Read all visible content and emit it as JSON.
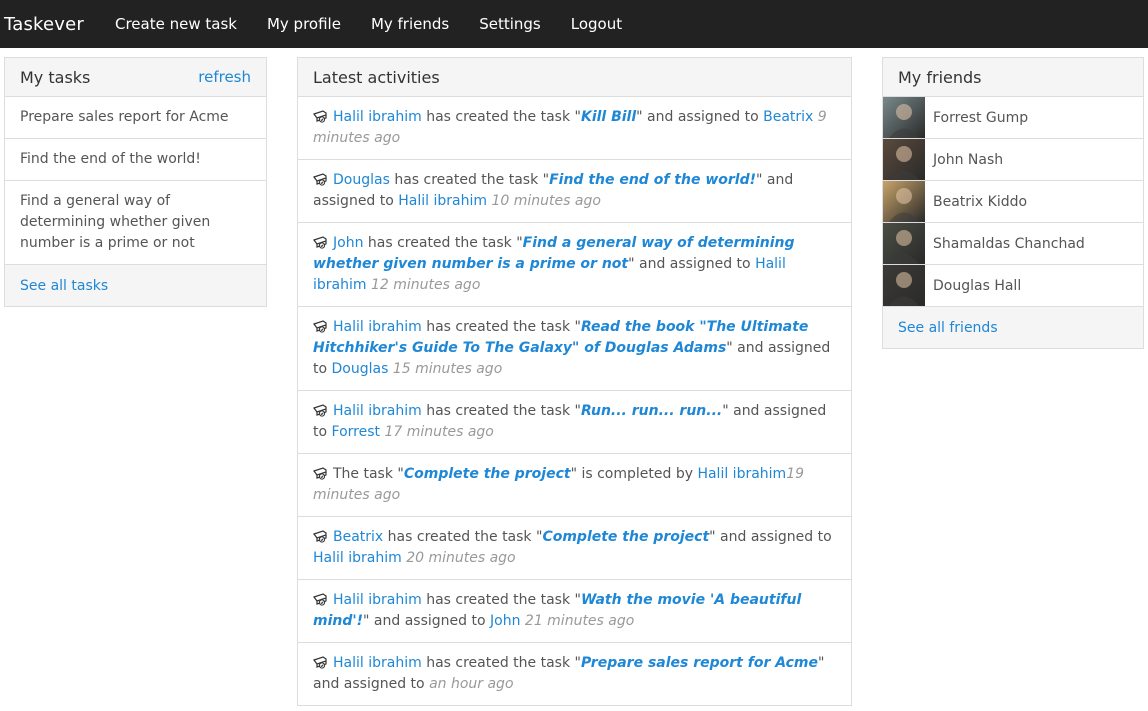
{
  "navbar": {
    "brand": "Taskever",
    "links": [
      "Create new task",
      "My profile",
      "My friends",
      "Settings",
      "Logout"
    ]
  },
  "my_tasks": {
    "title": "My tasks",
    "refresh_label": "refresh",
    "items": [
      "Prepare sales report for Acme",
      "Find the end of the world!",
      "Find a general way of determining whether given number is a prime or not"
    ],
    "see_all_label": "See all tasks"
  },
  "activities": {
    "title": "Latest activities",
    "items": [
      {
        "user": "Halil ibrahim",
        "pre": "has created the task \"",
        "task": "Kill Bill",
        "mid": "\" and assigned to ",
        "assignee": "Beatrix",
        "time": "9 minutes ago"
      },
      {
        "user": "Douglas",
        "pre": "has created the task \"",
        "task": "Find the end of the world!",
        "mid": "\" and assigned to ",
        "assignee": "Halil ibrahim",
        "time": "10 minutes ago"
      },
      {
        "user": "John",
        "pre": "has created the task \"",
        "task": "Find a general way of determining whether given number is a prime or not",
        "mid": "\" and assigned to ",
        "assignee": "Halil ibrahim",
        "time": "12 minutes ago"
      },
      {
        "user": "Halil ibrahim",
        "pre": "has created the task \"",
        "task": "Read the book \"The Ultimate Hitchhiker's Guide To The Galaxy\" of Douglas Adams",
        "mid": "\" and assigned to ",
        "assignee": "Douglas",
        "time": "15 minutes ago"
      },
      {
        "user": "Halil ibrahim",
        "pre": "has created the task \"",
        "task": "Run... run... run...",
        "mid": "\" and assigned to ",
        "assignee": "Forrest",
        "time": "17 minutes ago"
      },
      {
        "completed": true,
        "pre": "The task \"",
        "task": "Complete the project",
        "mid": "\" is completed by ",
        "assignee": "Halil ibrahim",
        "time": "19 minutes ago"
      },
      {
        "user": "Beatrix",
        "pre": "has created the task \"",
        "task": "Complete the project",
        "mid": "\" and assigned to ",
        "assignee": "Halil ibrahim",
        "time": "20 minutes ago"
      },
      {
        "user": "Halil ibrahim",
        "pre": "has created the task \"",
        "task": "Wath the movie 'A beautiful mind'!",
        "mid": "\" and assigned to ",
        "assignee": "John",
        "time": "21 minutes ago"
      },
      {
        "user": "Halil ibrahim",
        "pre": "has created the task \"",
        "task": "Prepare sales report for Acme",
        "mid": "\" and assigned to ",
        "assignee": "",
        "time": "an hour ago"
      }
    ]
  },
  "my_friends": {
    "title": "My friends",
    "items": [
      {
        "name": "Forrest Gump",
        "avatar_color": "#7a8a8c"
      },
      {
        "name": "John Nash",
        "avatar_color": "#5a4a3c"
      },
      {
        "name": "Beatrix Kiddo",
        "avatar_color": "#c9a46a"
      },
      {
        "name": "Shamaldas Chanchad",
        "avatar_color": "#4a4e44"
      },
      {
        "name": "Douglas Hall",
        "avatar_color": "#3c3a36"
      }
    ],
    "see_all_label": "See all friends"
  },
  "colors": {
    "navbar": "#222222",
    "link": "#1e87d6",
    "panel_head": "#f5f5f5",
    "border": "#dddddd"
  }
}
